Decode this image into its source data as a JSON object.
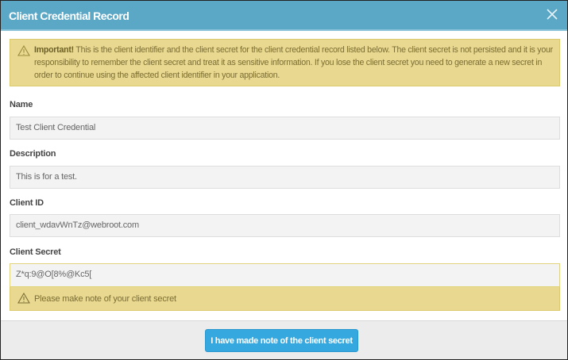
{
  "dialog": {
    "title": "Client Credential Record",
    "close_label": "Close"
  },
  "warning": {
    "strong": "Important!",
    "text": " This is the client identifier and the client secret for the client credential record listed below. The client secret is not persisted and it is your responsibility to remember the client secret and treat it as sensitive information. If you lose the client secret you need to generate a new secret in order to continue using the affected client identifier in your application."
  },
  "fields": {
    "name": {
      "label": "Name",
      "value": "Test Client Credential"
    },
    "description": {
      "label": "Description",
      "value": "This is for a test."
    },
    "client_id": {
      "label": "Client ID",
      "value": "client_wdavWnTz@webroot.com"
    },
    "client_secret": {
      "label": "Client Secret",
      "value": "Z*q:9@O[8%@Kc5[",
      "note": "Please make note of your client secret"
    }
  },
  "footer": {
    "confirm_label": "I have made note of the client secret"
  },
  "colors": {
    "header": "#5aa7c6",
    "warning": "#e9d990",
    "button": "#35a8e0"
  }
}
